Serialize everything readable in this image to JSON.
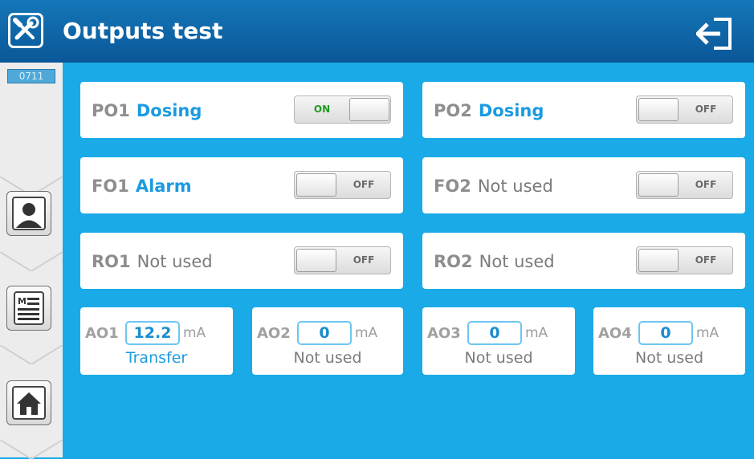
{
  "header": {
    "title": "Outputs test",
    "tools_icon": "tools-icon",
    "exit_icon": "exit-icon"
  },
  "sidebar": {
    "code": "0711",
    "buttons": [
      {
        "icon": "user-icon"
      },
      {
        "icon": "menu-list-icon"
      },
      {
        "icon": "home-icon"
      }
    ]
  },
  "outputs": [
    {
      "code": "PO1",
      "function": "Dosing",
      "state": "ON"
    },
    {
      "code": "PO2",
      "function": "Dosing",
      "state": "OFF"
    },
    {
      "code": "FO1",
      "function": "Alarm",
      "state": "OFF"
    },
    {
      "code": "FO2",
      "function": "Not used",
      "state": "OFF"
    },
    {
      "code": "RO1",
      "function": "Not used",
      "state": "OFF"
    },
    {
      "code": "RO2",
      "function": "Not used",
      "state": "OFF"
    }
  ],
  "analog": [
    {
      "code": "AO1",
      "value": "12.2",
      "unit": "mA",
      "function": "Transfer"
    },
    {
      "code": "AO2",
      "value": "0",
      "unit": "mA",
      "function": "Not used"
    },
    {
      "code": "AO3",
      "value": "0",
      "unit": "mA",
      "function": "Not used"
    },
    {
      "code": "AO4",
      "value": "0",
      "unit": "mA",
      "function": "Not used"
    }
  ],
  "colors": {
    "header": "#0a5798",
    "background": "#1aaae8",
    "accent": "#1a9be0",
    "on": "#1e9b1e"
  }
}
